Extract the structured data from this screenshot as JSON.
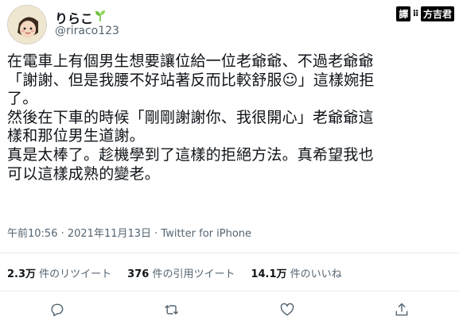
{
  "user": {
    "display_name": "りらこ",
    "handle": "@riraco123"
  },
  "watermark": {
    "box": "譯",
    "sep": "⠿",
    "name": "方吉君"
  },
  "tweet": {
    "text": "在電車上有個男生想要讓位給一位老爺爺、不過老爺爺\n「謝謝、但是我腰不好站著反而比較舒服☺」這樣婉拒\n了。\n然後在下車的時候「剛剛謝謝你、我很開心」老爺爺這\n樣和那位男生道謝。\n真是太棒了。趁機學到了這樣的拒絕方法。真希望我也\n可以這樣成熟的變老。"
  },
  "timestamp": "午前10:56 · 2021年11月13日 · Twitter for iPhone",
  "stats": {
    "retweets": {
      "count": "2.3万",
      "label": " 件のリツイート"
    },
    "quotes": {
      "count": "376",
      "label": " 件の引用ツイート"
    },
    "likes": {
      "count": "14.1万",
      "label": " 件のいいね"
    }
  },
  "icons": {
    "sprout": "sprout-icon",
    "reply": "reply-icon",
    "retweet": "retweet-icon",
    "like": "like-icon",
    "share": "share-icon"
  },
  "colors": {
    "text": "#0f1419",
    "secondary": "#536471",
    "divider": "#e7e9ea",
    "sprout": "#6bbf3a"
  }
}
